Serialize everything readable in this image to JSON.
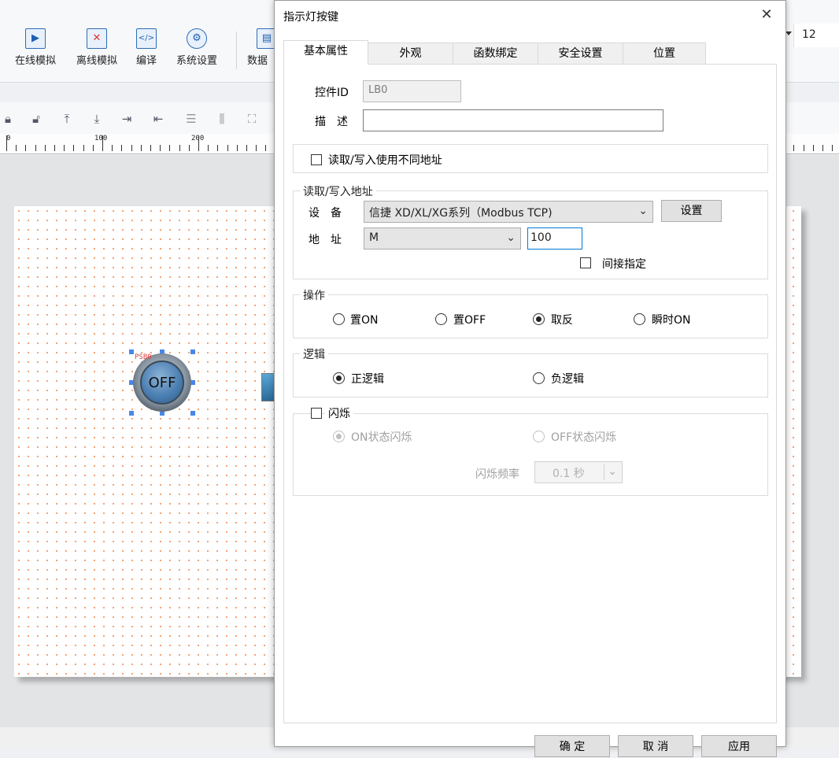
{
  "toolbar": {
    "buttons": [
      {
        "label": "在线模拟",
        "icon": "online-simulate-icon"
      },
      {
        "label": "离线模拟",
        "icon": "offline-simulate-icon"
      },
      {
        "label": "编译",
        "icon": "compile-icon"
      },
      {
        "label": "系统设置",
        "icon": "gear-icon"
      },
      {
        "label": "数据",
        "icon": "data-icon"
      }
    ],
    "font_size": "12"
  },
  "ruler": {
    "labels": [
      "0",
      "100",
      "200"
    ]
  },
  "canvas": {
    "lamp_tag": "PSB0",
    "lamp_text": "OFF"
  },
  "dialog": {
    "title": "指示灯按键",
    "close": "✕",
    "tabs": [
      "基本属性",
      "外观",
      "函数绑定",
      "安全设置",
      "位置"
    ],
    "control_id_label": "控件ID",
    "control_id_value": "LB0",
    "description_label": "描　述",
    "description_value": "",
    "rw_diff_label": "读取/写入使用不同地址",
    "rw_group_title": "读取/写入地址",
    "device_label": "设　备",
    "device_value": "信捷 XD/XL/XG系列（Modbus TCP)",
    "settings_button": "设置",
    "address_label": "地　址",
    "address_type": "M",
    "address_value": "100",
    "indirect_label": "间接指定",
    "operation_title": "操作",
    "operation_options": [
      "置ON",
      "置OFF",
      "取反",
      "瞬时ON"
    ],
    "operation_selected": 2,
    "logic_title": "逻辑",
    "logic_options": [
      "正逻辑",
      "负逻辑"
    ],
    "logic_selected": 0,
    "blink_title": "闪烁",
    "blink_options": [
      "ON状态闪烁",
      "OFF状态闪烁"
    ],
    "blink_selected": 0,
    "blink_freq_label": "闪烁频率",
    "blink_freq_value": "0.1 秒",
    "buttons": [
      "确 定",
      "取 消",
      "应用"
    ]
  }
}
